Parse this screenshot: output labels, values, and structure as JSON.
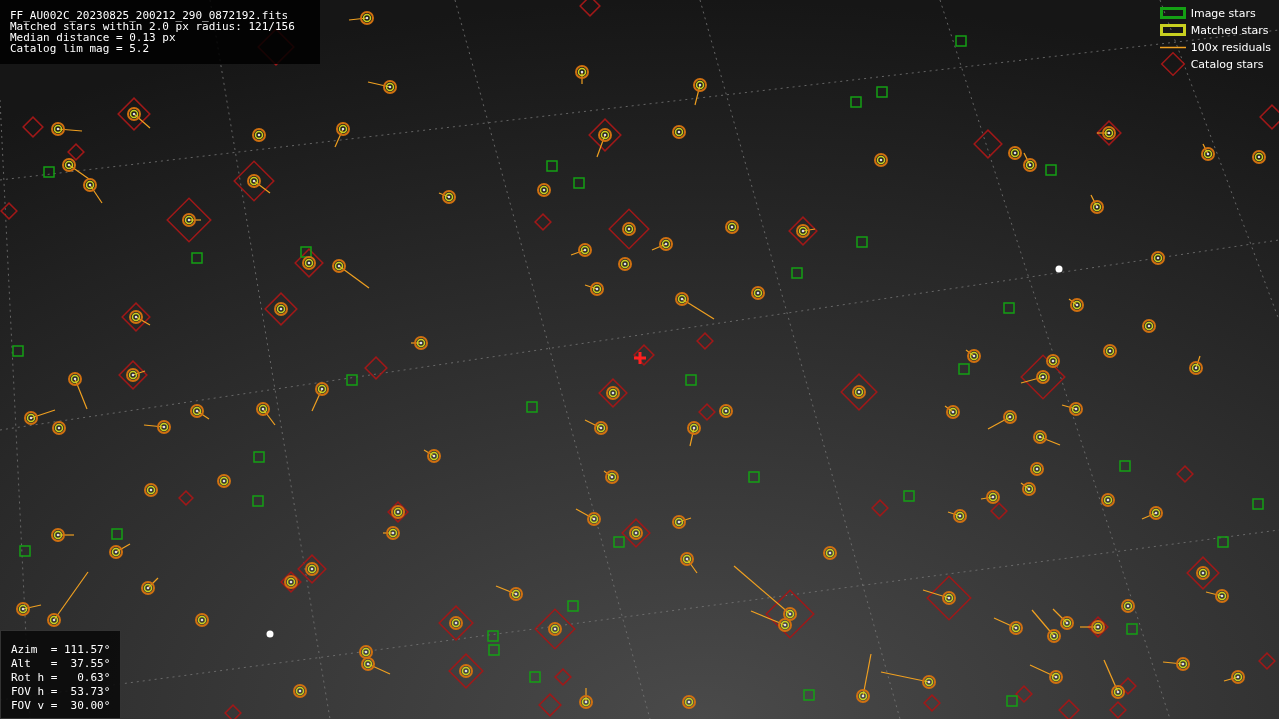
{
  "info": [
    "FF_AU002C_20230825_200212_290_0872192.fits",
    "Matched stars within 2.0 px radius: 121/156",
    "Median distance = 0.13 px",
    "Catalog lim mag = 5.2"
  ],
  "legend": [
    {
      "kind": "image",
      "label": "Image stars"
    },
    {
      "kind": "matched",
      "label": "Matched stars"
    },
    {
      "kind": "residual",
      "label": "100x residuals"
    },
    {
      "kind": "catalog",
      "label": "Catalog stars"
    }
  ],
  "pointing": [
    "Azim  = 111.57°",
    "Alt   =  37.55°",
    "Rot h =   0.63°",
    "FOV h =  53.73°",
    "FOV v =  30.00°"
  ]
}
